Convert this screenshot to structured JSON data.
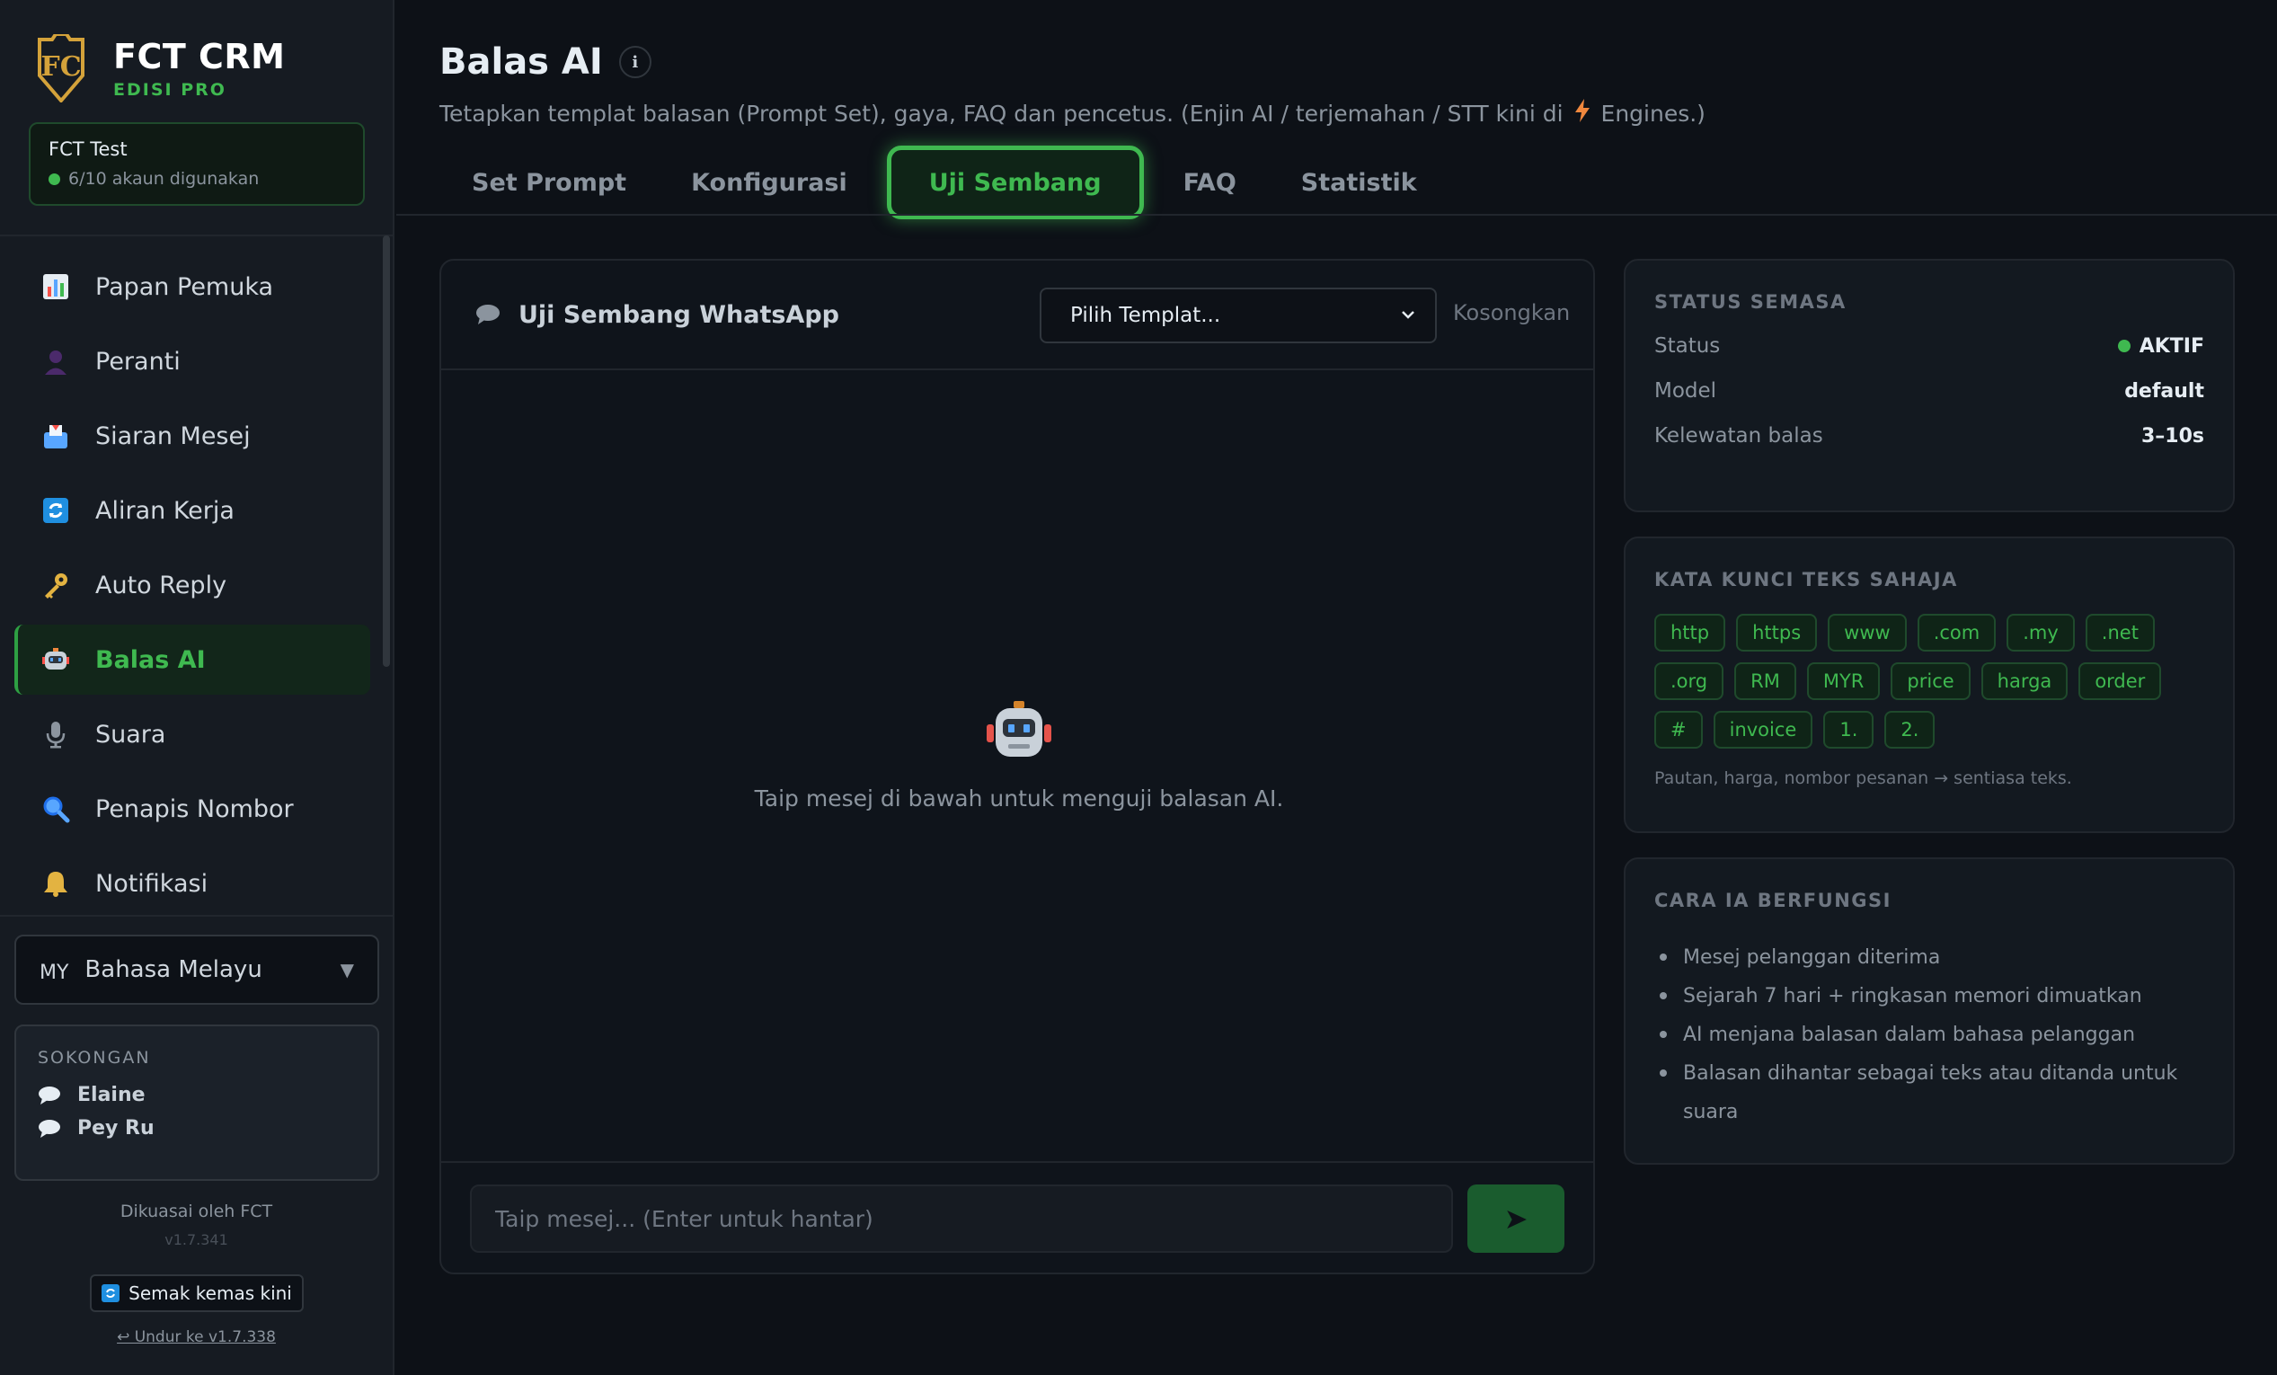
{
  "brand": {
    "name": "FCT CRM",
    "edition": "EDISI PRO",
    "logo_text": "FC"
  },
  "account": {
    "name": "FCT Test",
    "usage": "6/10 akaun digunakan"
  },
  "nav": {
    "items": [
      {
        "label": "Papan Pemuka",
        "icon": "chart-icon"
      },
      {
        "label": "Peranti",
        "icon": "person-icon"
      },
      {
        "label": "Siaran Mesej",
        "icon": "inbox-icon"
      },
      {
        "label": "Aliran Kerja",
        "icon": "refresh-icon"
      },
      {
        "label": "Auto Reply",
        "icon": "key-icon"
      },
      {
        "label": "Balas AI",
        "icon": "robot-icon"
      },
      {
        "label": "Suara",
        "icon": "microphone-icon"
      },
      {
        "label": "Penapis Nombor",
        "icon": "magnifier-icon"
      },
      {
        "label": "Notifikasi",
        "icon": "bell-icon"
      }
    ],
    "active_index": 5
  },
  "language": {
    "code": "MY",
    "label": "Bahasa Melayu"
  },
  "support": {
    "title": "SOKONGAN",
    "contacts": [
      "Elaine",
      "Pey Ru"
    ]
  },
  "footer": {
    "powered": "Dikuasai oleh FCT",
    "version": "v1.7.341",
    "check_update": "Semak kemas kini",
    "rollback": "↩ Undur ke v1.7.338"
  },
  "page": {
    "title": "Balas AI",
    "subtitle_before": "Tetapkan templat balasan (Prompt Set), gaya, FAQ dan pencetus. (Enjin AI / terjemahan / STT kini di",
    "subtitle_after": "Engines.)"
  },
  "tabs": [
    {
      "label": "Set Prompt"
    },
    {
      "label": "Konfigurasi"
    },
    {
      "label": "Uji Sembang"
    },
    {
      "label": "FAQ"
    },
    {
      "label": "Statistik"
    }
  ],
  "active_tab": 2,
  "chat": {
    "title": "Uji Sembang WhatsApp",
    "template_placeholder": "Pilih Templat...",
    "clear_label": "Kosongkan",
    "empty_text": "Taip mesej di bawah untuk menguji balasan AI.",
    "input_placeholder": "Taip mesej... (Enter untuk hantar)",
    "send_label": "➤"
  },
  "status_card": {
    "title": "STATUS SEMASA",
    "rows": [
      {
        "label": "Status",
        "value": "AKTIF"
      },
      {
        "label": "Model",
        "value": "default"
      },
      {
        "label": "Kelewatan balas",
        "value": "3–10s"
      }
    ]
  },
  "keywords_card": {
    "title": "KATA KUNCI TEKS SAHAJA",
    "chips": [
      "http",
      "https",
      "www",
      ".com",
      ".my",
      ".net",
      ".org",
      "RM",
      "MYR",
      "price",
      "harga",
      "order",
      "#",
      "invoice",
      "1.",
      "2."
    ],
    "note": "Pautan, harga, nombor pesanan → sentiasa teks."
  },
  "how_card": {
    "title": "CARA IA BERFUNGSI",
    "steps": [
      "Mesej pelanggan diterima",
      "Sejarah 7 hari + ringkasan memori dimuatkan",
      "AI menjana balasan dalam bahasa pelanggan",
      "Balasan dihantar sebagai teks atau ditanda untuk suara"
    ]
  },
  "colors": {
    "accent": "#3fb950",
    "background": "#0d1117",
    "sidebar": "#161b22"
  }
}
